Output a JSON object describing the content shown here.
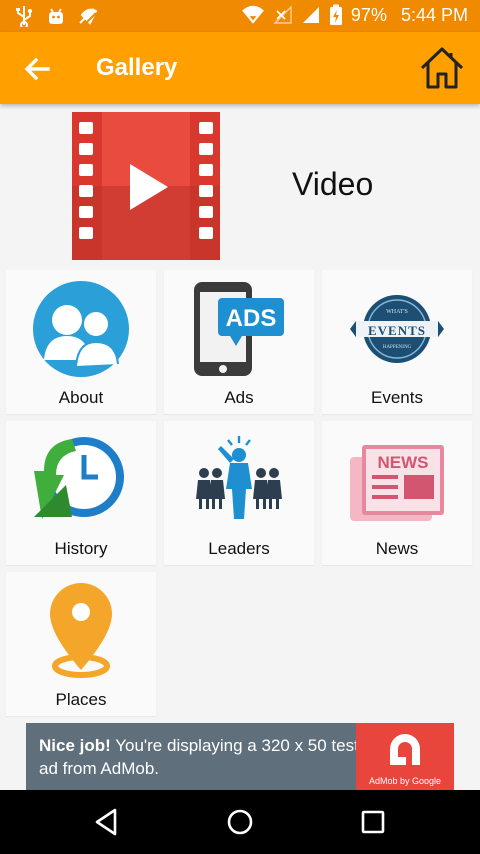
{
  "status_bar": {
    "battery": "97%",
    "time": "5:44 PM",
    "icons": [
      "usb-icon",
      "android-icon",
      "notification-icon",
      "wifi-icon",
      "no-signal-icon",
      "signal-icon",
      "battery-charging-icon"
    ]
  },
  "app_bar": {
    "title": "Gallery",
    "back_icon": "arrow-left-icon",
    "home_icon": "home-icon",
    "background": "#ffa000"
  },
  "video": {
    "label": "Video",
    "icon": "video-film-icon"
  },
  "tiles": [
    {
      "label": "About",
      "icon": "about-people-icon"
    },
    {
      "label": "Ads",
      "icon": "ads-phone-icon"
    },
    {
      "label": "Events",
      "icon": "events-badge-icon"
    },
    {
      "label": "History",
      "icon": "history-clock-icon"
    },
    {
      "label": "Leaders",
      "icon": "leaders-group-icon"
    },
    {
      "label": "News",
      "icon": "news-paper-icon"
    },
    {
      "label": "Places",
      "icon": "place-pin-icon"
    }
  ],
  "ad": {
    "bold": "Nice job!",
    "text": " You're displaying a 320 x 50 test ad from AdMob.",
    "caption": "AdMob by Google"
  },
  "nav": {
    "back": "nav-back-icon",
    "home": "nav-home-icon",
    "recents": "nav-recents-icon"
  }
}
